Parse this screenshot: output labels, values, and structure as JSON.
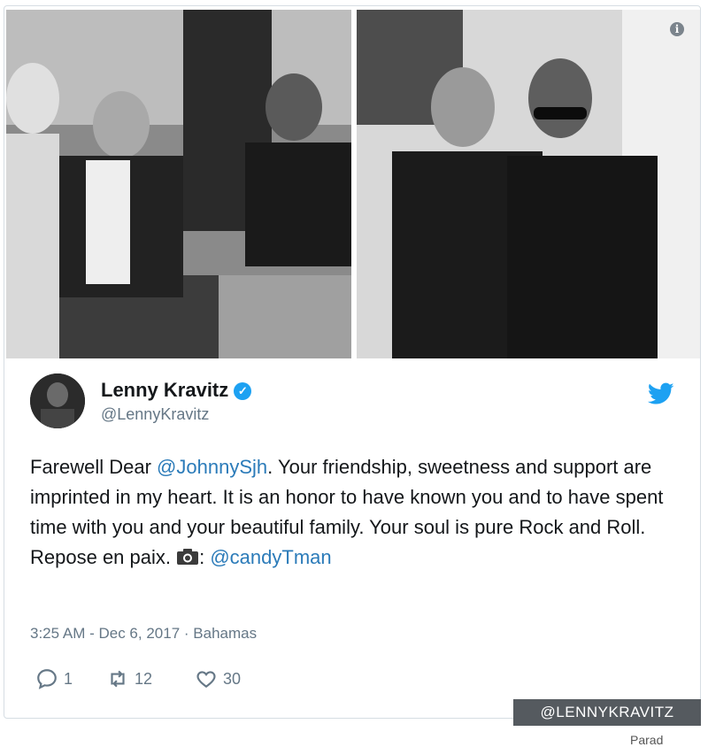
{
  "header": {
    "info_icon_glyph": "i"
  },
  "photos": [
    {
      "name": "photo-left",
      "description_icon": "photo"
    },
    {
      "name": "photo-right",
      "description_icon": "photo"
    }
  ],
  "tweet": {
    "author": {
      "display_name": "Lenny Kravitz",
      "handle": "@LennyKravitz",
      "verified_icon": "verified-check-icon"
    },
    "text_parts": {
      "p1": "Farewell Dear ",
      "mention1": "@JohnnySjh",
      "p2": ". Your friendship, sweetness and support are imprinted in my heart. It is an honor to have known you and to have spent time with you and your beautiful family. Your soul is pure Rock and Roll. Repose en paix. ",
      "p3": ": ",
      "mention2": "@candyTman"
    },
    "meta": {
      "time": "3:25 AM - Dec 6, 2017",
      "separator": "·",
      "location": "Bahamas"
    },
    "actions": {
      "replies": "1",
      "retweets": "12",
      "likes": "30"
    }
  },
  "watermark": "@LENNYKRAVITZ",
  "bottom_fragment": "Parad",
  "colors": {
    "link": "#2b7bb9",
    "twitter_blue": "#1da1f2",
    "muted": "#657786",
    "watermark_bg": "#555a5f"
  }
}
